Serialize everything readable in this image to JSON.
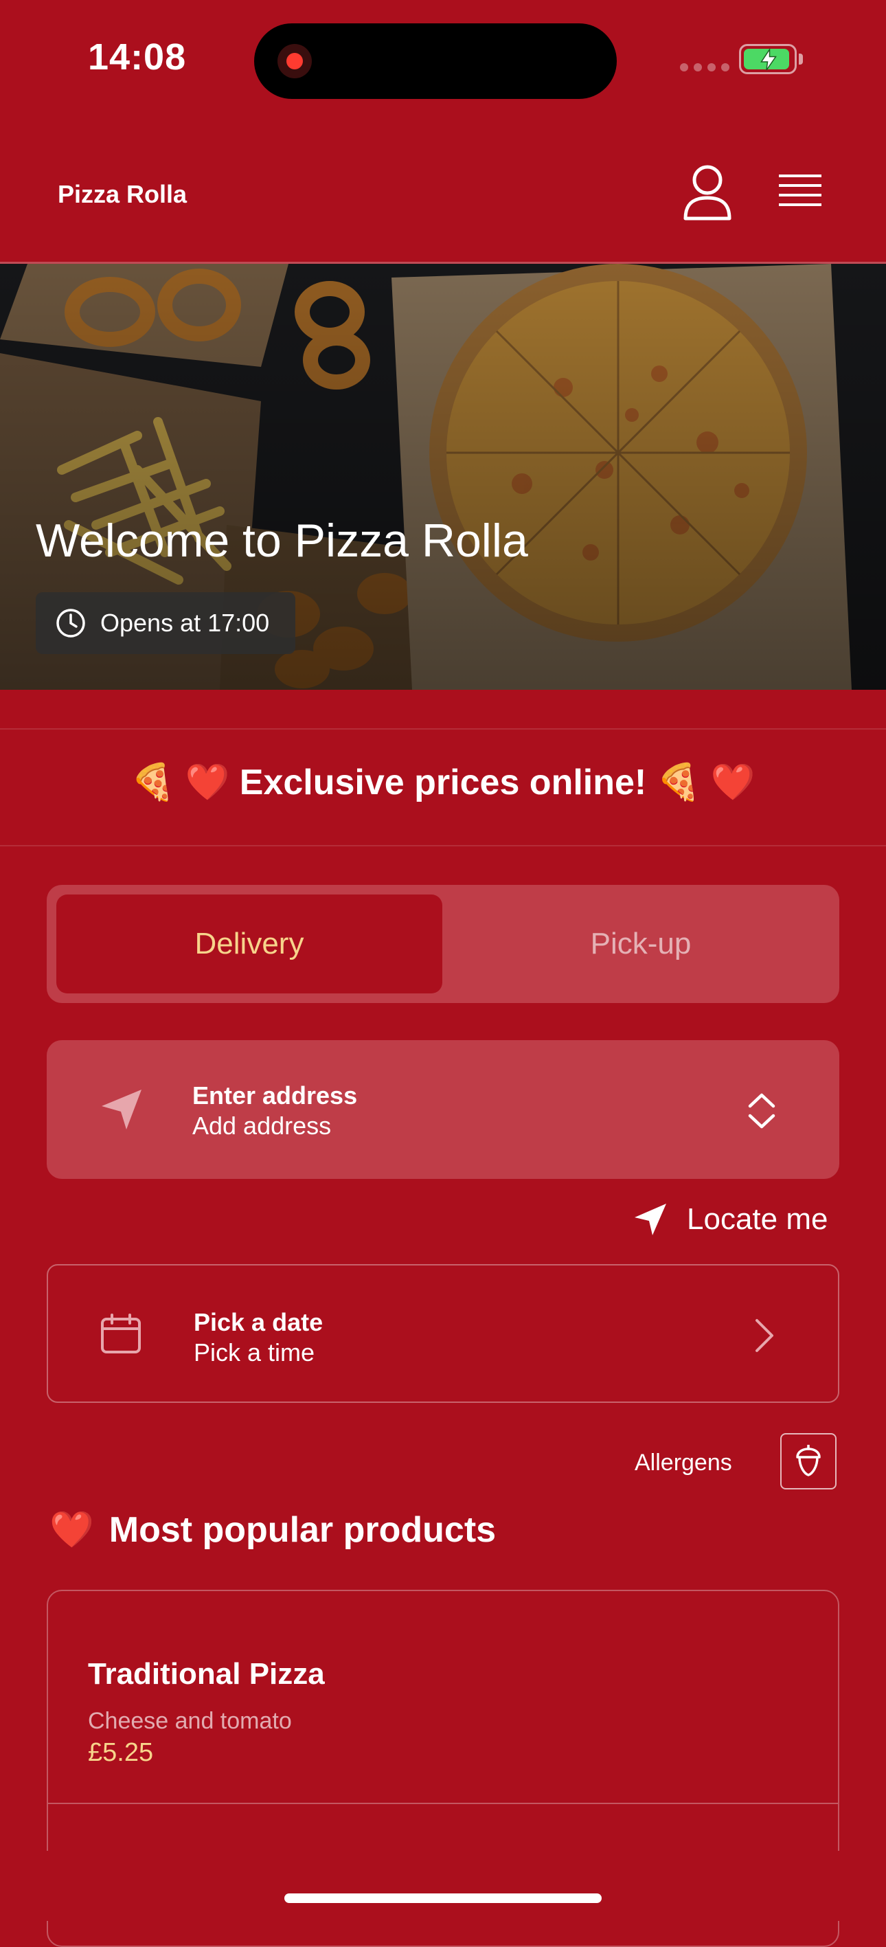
{
  "status_bar": {
    "time": "14:08"
  },
  "header": {
    "brand": "Pizza Rolla"
  },
  "hero": {
    "title": "Welcome to Pizza Rolla",
    "opening_text": "Opens at 17:00"
  },
  "promo": {
    "text": "🍕 ❤️ Exclusive prices online! 🍕 ❤️"
  },
  "order_mode": {
    "tabs": [
      "Delivery",
      "Pick-up"
    ],
    "selected": "Delivery"
  },
  "address": {
    "title": "Enter address",
    "subtitle": "Add address"
  },
  "locate": {
    "label": "Locate me"
  },
  "schedule": {
    "title": "Pick a date",
    "subtitle": "Pick a time"
  },
  "allergens": {
    "label": "Allergens"
  },
  "popular": {
    "heading_emoji": "❤️",
    "heading": "Most popular products",
    "products": [
      {
        "name": "Traditional Pizza",
        "description": "Cheese and tomato",
        "price": "£5.25"
      }
    ]
  },
  "colors": {
    "brand_red": "#AB0F1D",
    "card_tint": "#BF3D48",
    "accent_gold": "#F7D48B",
    "battery_green": "#4cd964"
  },
  "icons": [
    "record-icon",
    "battery-icon",
    "user-icon",
    "menu-icon",
    "clock-icon",
    "navigation-arrow-icon",
    "up-down-chevron-icon",
    "location-arrow-icon",
    "calendar-icon",
    "chevron-right-icon",
    "acorn-icon"
  ]
}
